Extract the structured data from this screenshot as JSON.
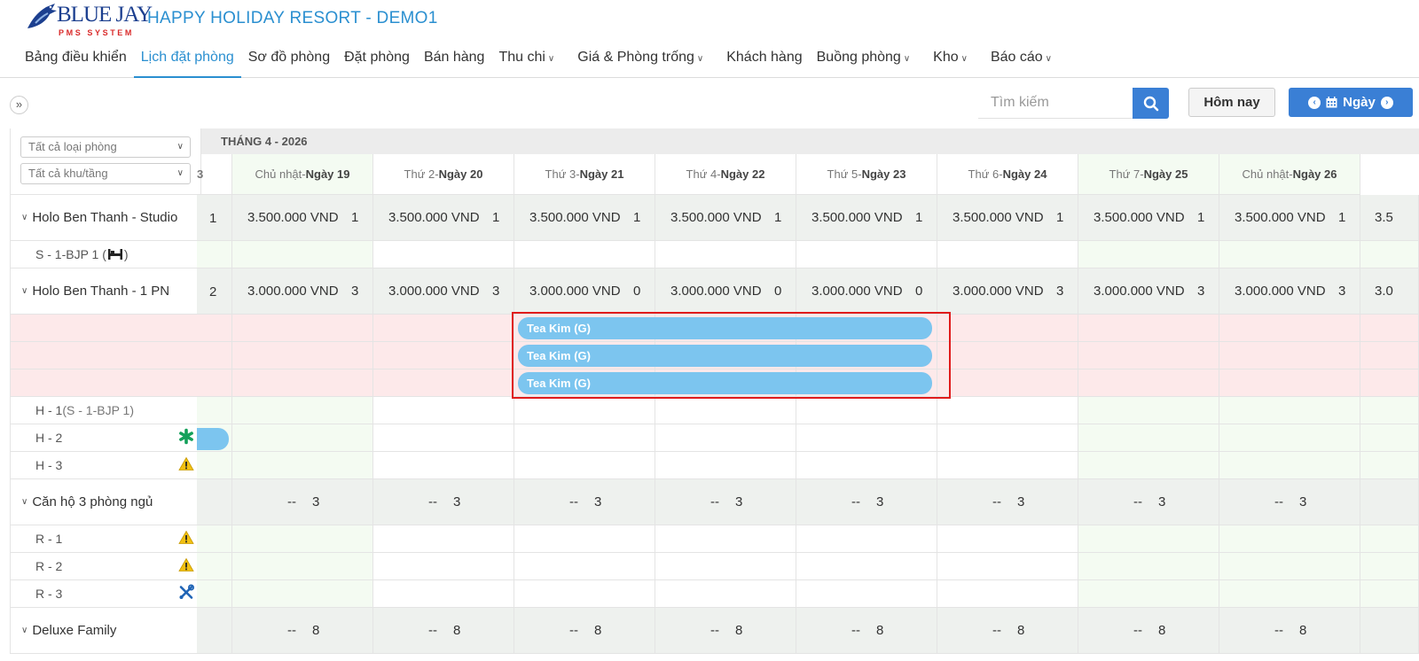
{
  "app": {
    "logo_text": "BLUE JAY",
    "logo_sub": "PMS SYSTEM",
    "title": "HAPPY HOLIDAY RESORT - DEMO1"
  },
  "nav": [
    {
      "label": "Bảng điều khiển",
      "active": false,
      "dropdown": false
    },
    {
      "label": "Lịch đặt phòng",
      "active": true,
      "dropdown": false
    },
    {
      "label": "Sơ đồ phòng",
      "active": false,
      "dropdown": false
    },
    {
      "label": "Đặt phòng",
      "active": false,
      "dropdown": false
    },
    {
      "label": "Bán hàng",
      "active": false,
      "dropdown": false
    },
    {
      "label": "Thu chi",
      "active": false,
      "dropdown": true
    },
    {
      "label": "Giá & Phòng trống",
      "active": false,
      "dropdown": true
    },
    {
      "label": "Khách hàng",
      "active": false,
      "dropdown": false
    },
    {
      "label": "Buồng phòng",
      "active": false,
      "dropdown": true
    },
    {
      "label": "Kho",
      "active": false,
      "dropdown": true
    },
    {
      "label": "Báo cáo",
      "active": false,
      "dropdown": true
    }
  ],
  "toolbar": {
    "search_placeholder": "Tìm kiếm",
    "today_label": "Hôm nay",
    "day_label": "Ngày"
  },
  "filters": {
    "room_type": "Tất cả loại phòng",
    "area_floor": "Tất cả khu/tầng"
  },
  "calendar": {
    "month_label": "THÁNG 4 - 2026",
    "partial_prev_day": "3",
    "days": [
      {
        "weekday": "Chủ nhật-",
        "day": "Ngày 19",
        "weekend": true
      },
      {
        "weekday": "Thứ 2-",
        "day": "Ngày 20",
        "weekend": false
      },
      {
        "weekday": "Thứ 3-",
        "day": "Ngày 21",
        "weekend": false
      },
      {
        "weekday": "Thứ 4-",
        "day": "Ngày 22",
        "weekend": false
      },
      {
        "weekday": "Thứ 5-",
        "day": "Ngày 23",
        "weekend": false
      },
      {
        "weekday": "Thứ 6-",
        "day": "Ngày 24",
        "weekend": false
      },
      {
        "weekday": "Thứ 7-",
        "day": "Ngày 25",
        "weekend": true
      },
      {
        "weekday": "Chủ nhật-",
        "day": "Ngày 26",
        "weekend": true
      }
    ],
    "rows": [
      {
        "kind": "group",
        "label": "Holo Ben Thanh - Studio",
        "first": "1",
        "cells": [
          {
            "price": "3.500.000 VND",
            "count": "1"
          },
          {
            "price": "3.500.000 VND",
            "count": "1"
          },
          {
            "price": "3.500.000 VND",
            "count": "1"
          },
          {
            "price": "3.500.000 VND",
            "count": "1"
          },
          {
            "price": "3.500.000 VND",
            "count": "1"
          },
          {
            "price": "3.500.000 VND",
            "count": "1"
          },
          {
            "price": "3.500.000 VND",
            "count": "1"
          },
          {
            "price": "3.500.000 VND",
            "count": "1"
          }
        ],
        "overflow": "3.5"
      },
      {
        "kind": "room",
        "label": "S - 1-BJP 1 (",
        "label_suffix": ")",
        "icon": "bed-icon"
      },
      {
        "kind": "group",
        "label": "Holo Ben Thanh - 1 PN",
        "first": "2",
        "cells": [
          {
            "price": "3.000.000 VND",
            "count": "3"
          },
          {
            "price": "3.000.000 VND",
            "count": "3"
          },
          {
            "price": "3.000.000 VND",
            "count": "0"
          },
          {
            "price": "3.000.000 VND",
            "count": "0"
          },
          {
            "price": "3.000.000 VND",
            "count": "0"
          },
          {
            "price": "3.000.000 VND",
            "count": "3"
          },
          {
            "price": "3.000.000 VND",
            "count": "3"
          },
          {
            "price": "3.000.000 VND",
            "count": "3"
          }
        ],
        "overflow": "3.0"
      },
      {
        "kind": "unassigned",
        "booking": "Tea Kim (G)"
      },
      {
        "kind": "unassigned",
        "booking": "Tea Kim (G)"
      },
      {
        "kind": "unassigned",
        "booking": "Tea Kim (G)"
      },
      {
        "kind": "room",
        "label": "H - 1",
        "label_note": " (S - 1-BJP 1)"
      },
      {
        "kind": "room",
        "label": "H - 2",
        "icon": "asterisk-icon",
        "partial_booking": true
      },
      {
        "kind": "room",
        "label": "H - 3",
        "icon": "warning-icon"
      },
      {
        "kind": "group",
        "label": "Căn hộ 3 phòng ngủ",
        "first": "",
        "cells": [
          {
            "price": "--",
            "count": "3"
          },
          {
            "price": "--",
            "count": "3"
          },
          {
            "price": "--",
            "count": "3"
          },
          {
            "price": "--",
            "count": "3"
          },
          {
            "price": "--",
            "count": "3"
          },
          {
            "price": "--",
            "count": "3"
          },
          {
            "price": "--",
            "count": "3"
          },
          {
            "price": "--",
            "count": "3"
          }
        ],
        "overflow": ""
      },
      {
        "kind": "room",
        "label": "R - 1",
        "icon": "warning-icon"
      },
      {
        "kind": "room",
        "label": "R - 2",
        "icon": "warning-icon"
      },
      {
        "kind": "room",
        "label": "R - 3",
        "icon": "tools-icon"
      },
      {
        "kind": "group",
        "label": "Deluxe Family",
        "first": "",
        "cells": [
          {
            "price": "--",
            "count": "8"
          },
          {
            "price": "--",
            "count": "8"
          },
          {
            "price": "--",
            "count": "8"
          },
          {
            "price": "--",
            "count": "8"
          },
          {
            "price": "--",
            "count": "8"
          },
          {
            "price": "--",
            "count": "8"
          },
          {
            "price": "--",
            "count": "8"
          },
          {
            "price": "--",
            "count": "8"
          }
        ],
        "overflow": ""
      }
    ]
  },
  "colors": {
    "accent": "#2a8fd0",
    "button_blue": "#3a7fd5",
    "booking_bar": "#7cc5ef",
    "unassigned_bg": "#fde9ea",
    "weekend_bg": "#f4fbf2",
    "group_bg": "#eef1ee",
    "highlight": "#e01b1b"
  }
}
